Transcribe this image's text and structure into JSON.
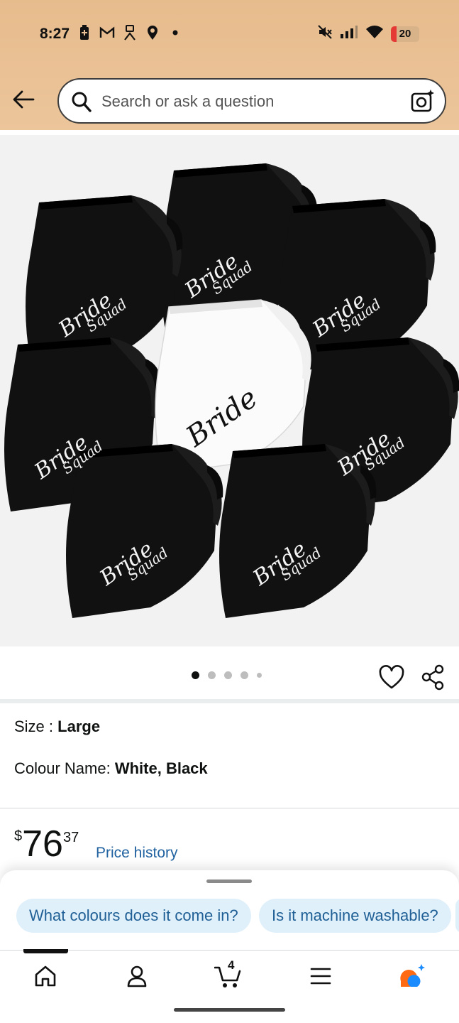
{
  "status_bar": {
    "time": "8:27",
    "battery": "20",
    "left_icons": [
      "battery-saver-icon",
      "gmail-icon",
      "accessibility-icon",
      "location-icon",
      "dot-icon"
    ],
    "right_icons": [
      "mute-icon",
      "signal-icon",
      "wifi-icon",
      "battery-icon"
    ]
  },
  "header": {
    "search_placeholder": "Search or ask a question"
  },
  "gallery": {
    "image_count": 5,
    "active_index": 0,
    "garment_text": [
      "Bride",
      "Squad"
    ]
  },
  "product": {
    "size_label": "Size : ",
    "size_value": "Large",
    "colour_label": "Colour Name: ",
    "colour_value": "White, Black",
    "price_currency": "$",
    "price_whole": "76",
    "price_fraction": "37",
    "price_history": "Price history"
  },
  "suggestions": [
    {
      "label": "What colours does it come in?"
    },
    {
      "label": "Is it machine washable?"
    }
  ],
  "bottom_nav": {
    "cart_count": "4",
    "items": [
      "home-icon",
      "account-icon",
      "cart-icon",
      "menu-icon",
      "rufus-icon"
    ]
  },
  "colors": {
    "header_bg": "#e7bc8d",
    "link": "#2162a1",
    "chip_bg": "#dff0fb",
    "chip_text": "#1f5f95"
  }
}
